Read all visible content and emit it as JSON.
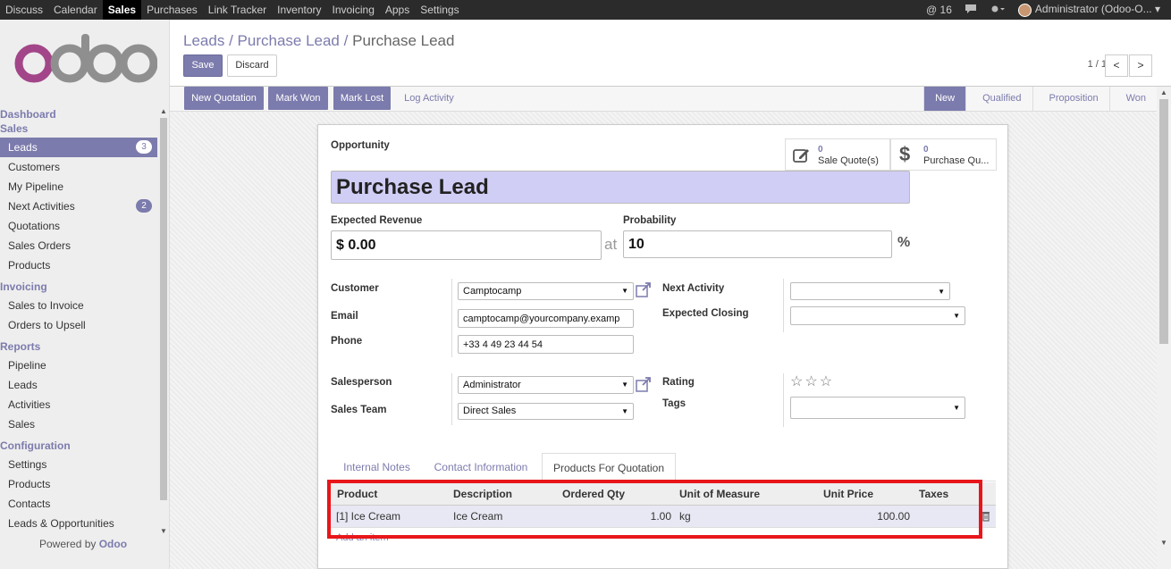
{
  "topbar": {
    "menu": [
      "Discuss",
      "Calendar",
      "Sales",
      "Purchases",
      "Link Tracker",
      "Inventory",
      "Invoicing",
      "Apps",
      "Settings"
    ],
    "active_menu": "Sales",
    "mentions": "@ 16",
    "user": "Administrator (Odoo-O..."
  },
  "sidebar": {
    "logo": "odoo",
    "dashboard": "Dashboard",
    "sales_section": "Sales",
    "sales_items": [
      {
        "label": "Leads",
        "badge": "3"
      },
      {
        "label": "Customers",
        "badge": ""
      },
      {
        "label": "My Pipeline",
        "badge": ""
      },
      {
        "label": "Next Activities",
        "badge": "2"
      },
      {
        "label": "Quotations",
        "badge": ""
      },
      {
        "label": "Sales Orders",
        "badge": ""
      },
      {
        "label": "Products",
        "badge": ""
      }
    ],
    "invoicing_section": "Invoicing",
    "invoicing_items": [
      "Sales to Invoice",
      "Orders to Upsell"
    ],
    "reports_section": "Reports",
    "reports_items": [
      "Pipeline",
      "Leads",
      "Activities",
      "Sales"
    ],
    "config_section": "Configuration",
    "config_items": [
      "Settings",
      "Products",
      "Contacts",
      "Leads & Opportunities"
    ],
    "powered_prefix": "Powered by",
    "powered_brand": "Odoo"
  },
  "control_panel": {
    "breadcrumb": [
      "Leads",
      "Purchase Lead"
    ],
    "current": "Purchase Lead",
    "sep": "/",
    "save": "Save",
    "discard": "Discard",
    "pager": "1 / 1",
    "prev": "<",
    "next": ">"
  },
  "statusbar": {
    "buttons": [
      "New Quotation",
      "Mark Won",
      "Mark Lost"
    ],
    "log_activity": "Log Activity",
    "stages": [
      "New",
      "Qualified",
      "Proposition",
      "Won"
    ],
    "active_stage": "New"
  },
  "form": {
    "type_label": "Opportunity",
    "smart_buttons": [
      {
        "count": "0",
        "label": "Sale Quote(s)",
        "icon": "pencil-square-icon"
      },
      {
        "count": "0",
        "label": "Purchase Qu...",
        "icon": "dollar-icon"
      }
    ],
    "name": "Purchase Lead",
    "expected_revenue_label": "Expected Revenue",
    "expected_revenue": "$ 0.00",
    "at": "at",
    "probability_label": "Probability",
    "probability": "10",
    "percent": "%",
    "customer_label": "Customer",
    "customer": "Camptocamp",
    "email_label": "Email",
    "email": "camptocamp@yourcompany.examp",
    "phone_label": "Phone",
    "phone": "+33 4 49 23 44 54",
    "next_activity_label": "Next Activity",
    "next_activity": "",
    "expected_closing_label": "Expected Closing",
    "expected_closing": "",
    "salesperson_label": "Salesperson",
    "salesperson": "Administrator",
    "sales_team_label": "Sales Team",
    "sales_team": "Direct Sales",
    "rating_label": "Rating",
    "rating_stars": "☆☆☆",
    "tags_label": "Tags",
    "tags": ""
  },
  "tabs": [
    "Internal Notes",
    "Contact Information",
    "Products For Quotation"
  ],
  "active_tab": "Products For Quotation",
  "products_table": {
    "headers": [
      "Product",
      "Description",
      "Ordered Qty",
      "Unit of Measure",
      "Unit Price",
      "Taxes"
    ],
    "rows": [
      {
        "product": "[1] Ice Cream",
        "description": "Ice Cream",
        "qty": "1.00",
        "uom": "kg",
        "price": "100.00",
        "taxes": ""
      }
    ],
    "add_item": "Add an item"
  },
  "colors": {
    "brand": "#7c7bad",
    "highlight": "#e8161a",
    "topbar": "#2b2b2b"
  }
}
